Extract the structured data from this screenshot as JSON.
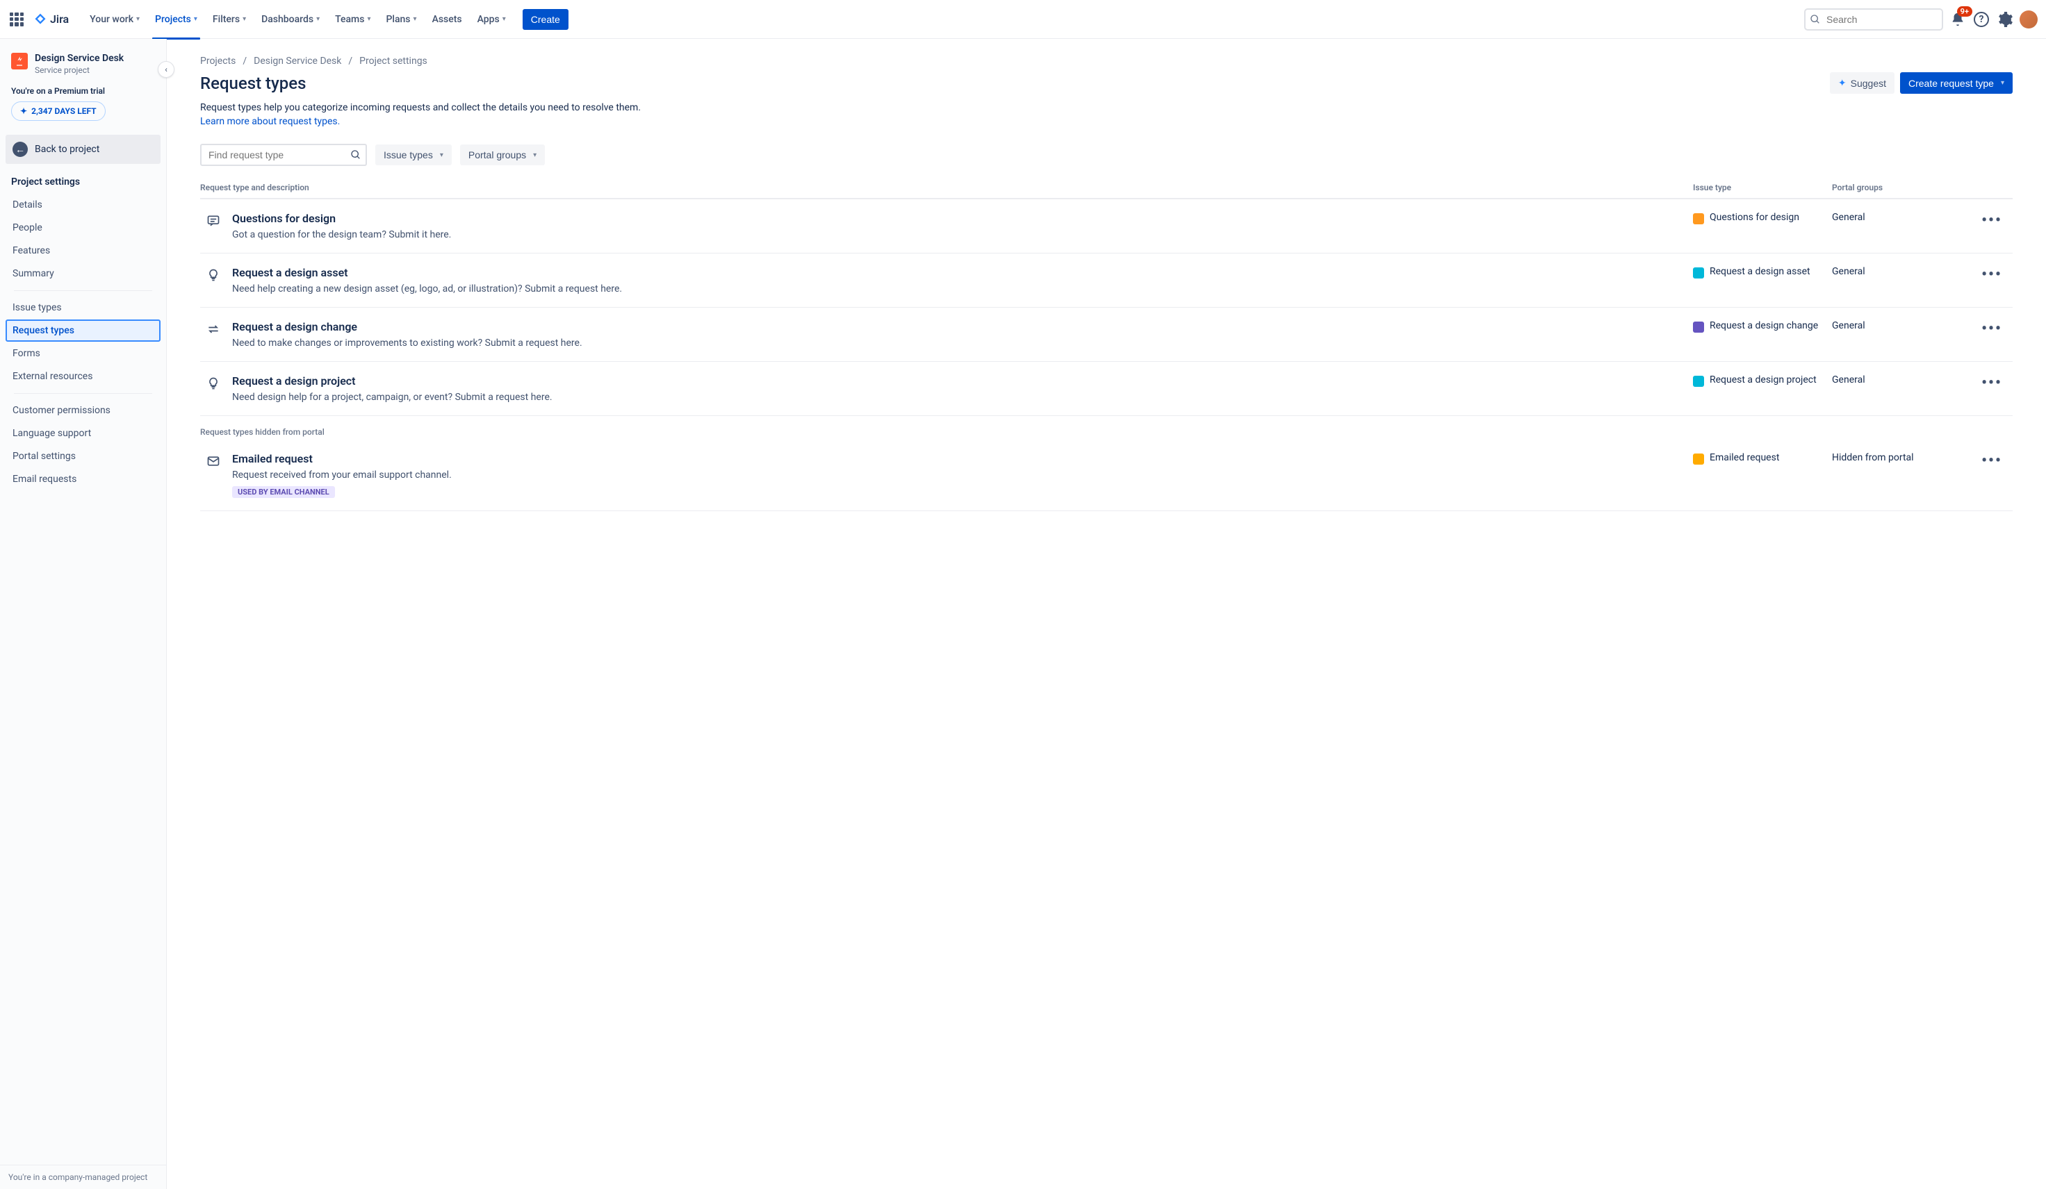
{
  "topbar": {
    "logoText": "Jira",
    "nav": [
      "Your work",
      "Projects",
      "Filters",
      "Dashboards",
      "Teams",
      "Plans",
      "Assets",
      "Apps"
    ],
    "activeNav": "Projects",
    "navNoChevron": [
      "Assets"
    ],
    "createLabel": "Create",
    "searchPlaceholder": "Search",
    "notifCount": "9+"
  },
  "sidebar": {
    "projectName": "Design Service Desk",
    "projectSub": "Service project",
    "trialLabel": "You're on a Premium trial",
    "trialDays": "2,347 DAYS LEFT",
    "backLabel": "Back to project",
    "heading": "Project settings",
    "group1": [
      "Details",
      "People",
      "Features",
      "Summary"
    ],
    "group2": [
      "Issue types",
      "Request types",
      "Forms",
      "External resources"
    ],
    "group3": [
      "Customer permissions",
      "Language support",
      "Portal settings",
      "Email requests"
    ],
    "selected": "Request types",
    "footer": "You're in a company-managed project"
  },
  "main": {
    "breadcrumbs": [
      "Projects",
      "Design Service Desk",
      "Project settings"
    ],
    "title": "Request types",
    "suggestLabel": "Suggest",
    "createRtLabel": "Create request type",
    "description": "Request types help you categorize incoming requests and collect the details you need to resolve them.",
    "learnMore": "Learn more about request types.",
    "findPlaceholder": "Find request type",
    "filterIssue": "Issue types",
    "filterPortal": "Portal groups",
    "columns": {
      "name": "Request type and description",
      "issue": "Issue type",
      "portal": "Portal groups"
    },
    "rows": [
      {
        "icon": "chat",
        "name": "Questions for design",
        "desc": "Got a question for the design team? Submit it here.",
        "issue": "Questions for design",
        "chipColor": "#FF991F",
        "portal": "General"
      },
      {
        "icon": "bulb",
        "name": "Request a design asset",
        "desc": "Need help creating a new design asset (eg, logo, ad, or illustration)? Submit a request here.",
        "issue": "Request a design asset",
        "chipColor": "#00B8D9",
        "portal": "General"
      },
      {
        "icon": "swap",
        "name": "Request a design change",
        "desc": "Need to make changes or improvements to existing work? Submit a request here.",
        "issue": "Request a design change",
        "chipColor": "#6554C0",
        "portal": "General"
      },
      {
        "icon": "bulb",
        "name": "Request a design project",
        "desc": "Need design help for a project, campaign, or event? Submit a request here.",
        "issue": "Request a design project",
        "chipColor": "#00B8D9",
        "portal": "General"
      }
    ],
    "hiddenHeading": "Request types hidden from portal",
    "hiddenRows": [
      {
        "icon": "mail",
        "name": "Emailed request",
        "desc": "Request received from your email support channel.",
        "issue": "Emailed request",
        "chipColor": "#FFAB00",
        "portal": "Hidden from portal",
        "badge": "USED BY EMAIL CHANNEL"
      }
    ]
  }
}
